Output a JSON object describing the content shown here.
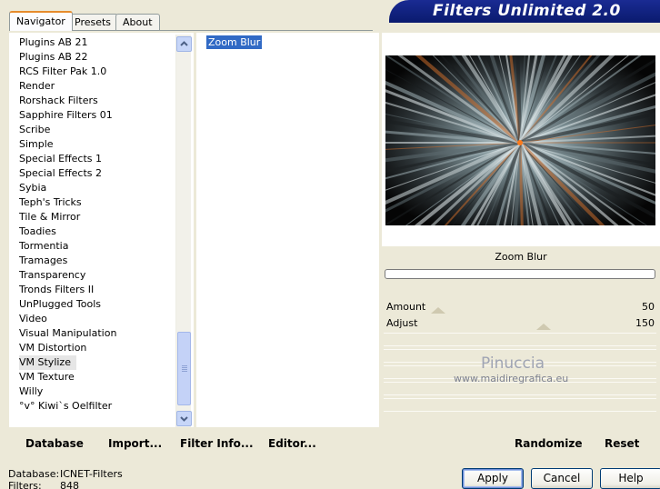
{
  "tabs": [
    "Navigator",
    "Presets",
    "About"
  ],
  "active_tab": "Navigator",
  "banner_title": "Filters Unlimited 2.0",
  "categories": [
    "Plugins AB 21",
    "Plugins AB 22",
    "RCS Filter Pak 1.0",
    "Render",
    "Rorshack Filters",
    "Sapphire Filters 01",
    "Scribe",
    "Simple",
    "Special Effects 1",
    "Special Effects 2",
    "Sybia",
    "Teph's Tricks",
    "Tile & Mirror",
    "Toadies",
    "Tormentia",
    "Tramages",
    "Transparency",
    "Tronds Filters II",
    "UnPlugged Tools",
    "Video",
    "Visual Manipulation",
    "VM Distortion",
    "VM Stylize",
    "VM Texture",
    "Willy",
    "°v° Kiwi`s Oelfilter"
  ],
  "selected_category": "VM Stylize",
  "filters": [
    "Zoom Blur"
  ],
  "selected_filter": "Zoom Blur",
  "preview_filter_name": "Zoom Blur",
  "controls": [
    {
      "label": "Amount",
      "value": "50"
    },
    {
      "label": "Adjust",
      "value": "150"
    }
  ],
  "watermark": {
    "title": "Pinuccia",
    "url": "www.maidiregrafica.eu"
  },
  "bottom_links": {
    "database": "Database",
    "import": "Import...",
    "filter_info": "Filter Info...",
    "editor": "Editor...",
    "randomize": "Randomize",
    "reset": "Reset"
  },
  "status": {
    "database_label": "Database:",
    "database_value": "ICNET-Filters",
    "filters_label": "Filters:",
    "filters_value": "848"
  },
  "buttons": {
    "apply": "Apply",
    "cancel": "Cancel",
    "help": "Help"
  },
  "colors": {
    "banner": "#1a2b93",
    "selection": "#316ac5",
    "window": "#ece9d8"
  }
}
